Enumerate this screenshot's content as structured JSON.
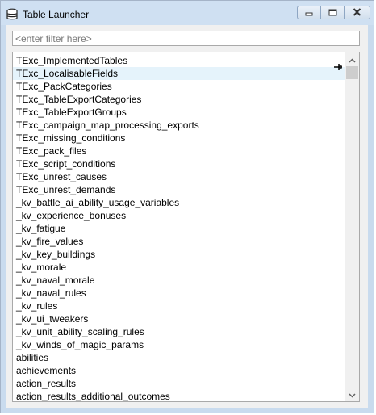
{
  "window": {
    "title": "Table Launcher",
    "icon": "database-icon"
  },
  "caption_buttons": {
    "minimize": "minimize-icon",
    "maximize": "maximize-icon",
    "close": "close-icon"
  },
  "filter": {
    "value": "",
    "placeholder": "<enter filter here>"
  },
  "tables": [
    "TExc_ImplementedTables",
    "TExc_LocalisableFields",
    "TExc_PackCategories",
    "TExc_TableExportCategories",
    "TExc_TableExportGroups",
    "TExc_campaign_map_processing_exports",
    "TExc_missing_conditions",
    "TExc_pack_files",
    "TExc_script_conditions",
    "TExc_unrest_causes",
    "TExc_unrest_demands",
    "_kv_battle_ai_ability_usage_variables",
    "_kv_experience_bonuses",
    "_kv_fatigue",
    "_kv_fire_values",
    "_kv_key_buildings",
    "_kv_morale",
    "_kv_naval_morale",
    "_kv_naval_rules",
    "_kv_rules",
    "_kv_ui_tweakers",
    "_kv_unit_ability_scaling_rules",
    "_kv_winds_of_magic_params",
    "abilities",
    "achievements",
    "action_results",
    "action_results_additional_outcomes"
  ],
  "hovered_index": 1,
  "scroll": {
    "position": 0.0
  },
  "colors": {
    "hover": "#e5f3fb",
    "titlebar": "#cfe0f2",
    "frame": "#c9dbee"
  }
}
